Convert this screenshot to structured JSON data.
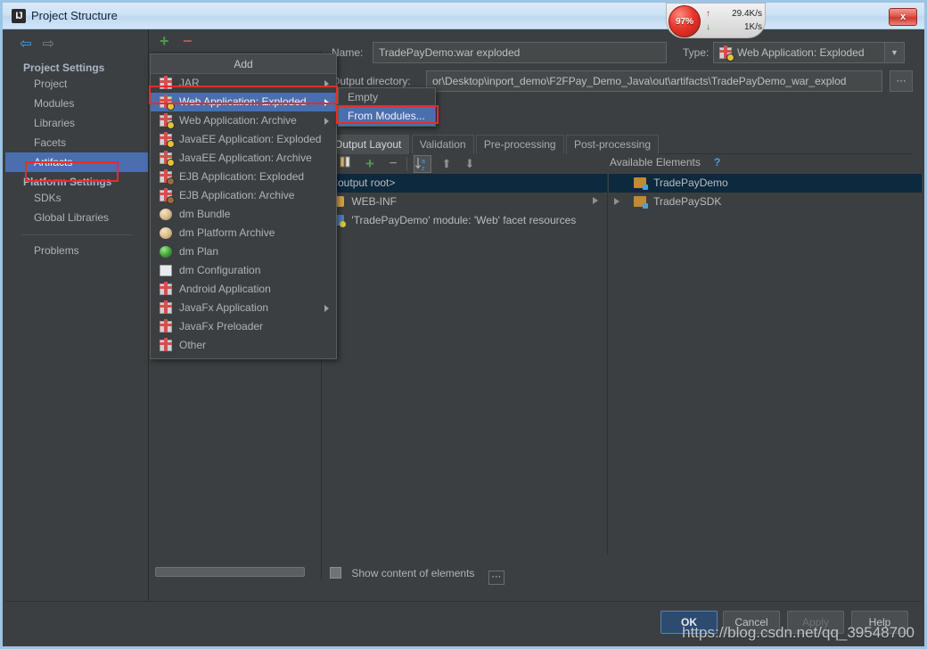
{
  "window": {
    "title": "Project Structure",
    "app_icon": "IJ",
    "close_label": "x"
  },
  "net_widget": {
    "percent": "97%",
    "up_arrow": "↑",
    "up_speed": "29.4K/s",
    "down_arrow": "↓",
    "down_speed": "1K/s"
  },
  "nav": {
    "back": "⇦",
    "forward": "⇨"
  },
  "sidebar": {
    "groups": [
      {
        "title": "Project Settings",
        "items": [
          {
            "label": "Project",
            "selected": false
          },
          {
            "label": "Modules",
            "selected": false
          },
          {
            "label": "Libraries",
            "selected": false
          },
          {
            "label": "Facets",
            "selected": false
          },
          {
            "label": "Artifacts",
            "selected": true
          }
        ]
      },
      {
        "title": "Platform Settings",
        "items": [
          {
            "label": "SDKs",
            "selected": false
          },
          {
            "label": "Global Libraries",
            "selected": false
          }
        ]
      }
    ],
    "extra": {
      "label": "Problems"
    }
  },
  "artifact_toolbar": {
    "add": "+",
    "remove": "−"
  },
  "add_menu": {
    "title": "Add",
    "items": [
      {
        "label": "JAR",
        "icon": "gift-icon",
        "badge": "",
        "submenu": true,
        "highlighted": false
      },
      {
        "label": "Web Application: Exploded",
        "icon": "gift-icon",
        "badge": "yellow",
        "submenu": true,
        "highlighted": true
      },
      {
        "label": "Web Application: Archive",
        "icon": "gift-icon",
        "badge": "yellow",
        "submenu": true,
        "highlighted": false
      },
      {
        "label": "JavaEE Application: Exploded",
        "icon": "gift-icon",
        "badge": "yellow",
        "submenu": false,
        "highlighted": false
      },
      {
        "label": "JavaEE Application: Archive",
        "icon": "gift-icon",
        "badge": "yellow",
        "submenu": false,
        "highlighted": false
      },
      {
        "label": "EJB Application: Exploded",
        "icon": "gift-icon",
        "badge": "brown",
        "submenu": false,
        "highlighted": false
      },
      {
        "label": "EJB Application: Archive",
        "icon": "gift-icon",
        "badge": "brown",
        "submenu": false,
        "highlighted": false
      },
      {
        "label": "dm Bundle",
        "icon": "ball-icon",
        "badge": "",
        "submenu": false,
        "highlighted": false
      },
      {
        "label": "dm Platform Archive",
        "icon": "ball-icon",
        "badge": "",
        "submenu": false,
        "highlighted": false
      },
      {
        "label": "dm Plan",
        "icon": "globe-icon",
        "badge": "",
        "submenu": false,
        "highlighted": false
      },
      {
        "label": "dm Configuration",
        "icon": "document-icon",
        "badge": "",
        "submenu": false,
        "highlighted": false
      },
      {
        "label": "Android Application",
        "icon": "gift-icon",
        "badge": "",
        "submenu": false,
        "highlighted": false
      },
      {
        "label": "JavaFx Application",
        "icon": "gift-icon",
        "badge": "",
        "submenu": true,
        "highlighted": false
      },
      {
        "label": "JavaFx Preloader",
        "icon": "gift-icon",
        "badge": "",
        "submenu": false,
        "highlighted": false
      },
      {
        "label": "Other",
        "icon": "gift-icon",
        "badge": "",
        "submenu": false,
        "highlighted": false
      }
    ]
  },
  "sub_menu": {
    "items": [
      {
        "label": "Empty",
        "highlighted": false
      },
      {
        "label": "From Modules...",
        "highlighted": true
      }
    ]
  },
  "detail": {
    "name_label": "Name:",
    "name_value": "TradePayDemo:war exploded",
    "type_label": "Type:",
    "type_value": "Web Application: Exploded",
    "type_caret": "▼",
    "output_label": "Output directory:",
    "output_value": "or\\Desktop\\inport_demo\\F2FPay_Demo_Java\\out\\artifacts\\TradePayDemo_war_explod",
    "browse_label": "⋯"
  },
  "tabs": [
    {
      "label": "Output Layout",
      "active": true
    },
    {
      "label": "Validation",
      "active": false
    },
    {
      "label": "Pre-processing",
      "active": false
    },
    {
      "label": "Post-processing",
      "active": false
    }
  ],
  "layout_toolbar": {
    "columns_icon": "columns-icon",
    "add_icon": "+",
    "remove_icon": "−",
    "sort_icon": "sort-az-icon",
    "up_icon": "⬆",
    "down_icon": "⬇",
    "available_label": "Available Elements",
    "help_label": "?"
  },
  "output_tree": [
    {
      "label": "<output root>",
      "icon": "none",
      "selected": true,
      "expandable": false
    },
    {
      "label": "WEB-INF",
      "icon": "folder-icon",
      "selected": false,
      "expandable": true
    },
    {
      "label": "'TradePayDemo' module: 'Web' facet resources",
      "icon": "facet-icon",
      "selected": false,
      "expandable": false
    }
  ],
  "available_tree": [
    {
      "label": "TradePayDemo",
      "icon": "module-icon",
      "selected": true,
      "expandable": false
    },
    {
      "label": "TradePaySDK",
      "icon": "module-icon",
      "selected": false,
      "expandable": true
    }
  ],
  "show_content": {
    "label": "Show content of elements",
    "checked": false,
    "more_label": "⋯"
  },
  "footer_buttons": [
    {
      "label": "OK",
      "kind": "primary"
    },
    {
      "label": "Cancel",
      "kind": "normal"
    },
    {
      "label": "Apply",
      "kind": "disabled"
    },
    {
      "label": "Help",
      "kind": "normal"
    }
  ],
  "watermark": "https://blog.csdn.net/qq_39548700"
}
